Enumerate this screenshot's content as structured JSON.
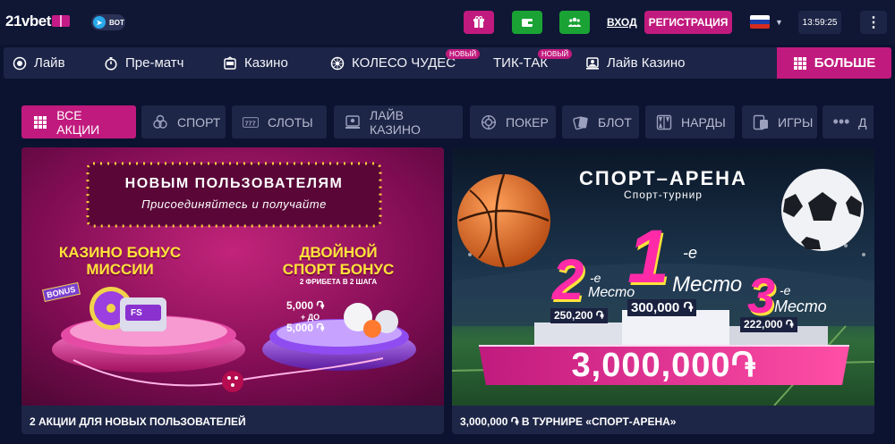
{
  "header": {
    "logo_text": "21vbet",
    "bot_label": "BOT",
    "login_label": "ВХОД",
    "register_label": "РЕГИСТРАЦИЯ",
    "time": "13:59:25",
    "language_flag": "ru",
    "icons": [
      "gift-icon",
      "wallet-icon",
      "group-icon",
      "telegram-icon",
      "chevron-down-icon",
      "kebab-icon"
    ]
  },
  "nav": {
    "items": [
      {
        "label": "Лайв",
        "icon": "live-icon"
      },
      {
        "label": "Пре-матч",
        "icon": "stopwatch-icon"
      },
      {
        "label": "Казино",
        "icon": "casino-icon"
      },
      {
        "label": "КОЛЕСО ЧУДЕС",
        "icon": "wheel-icon",
        "badge": "НОВЫЙ"
      },
      {
        "label": "ТИК-ТАК",
        "badge": "НОВЫЙ"
      },
      {
        "label": "Лайв Казино",
        "icon": "live-casino-icon"
      }
    ],
    "more_label": "БОЛЬШЕ"
  },
  "filters": {
    "tabs": [
      {
        "label": "ВСЕ АКЦИИ",
        "icon": "grid-icon",
        "active": true
      },
      {
        "label": "СПОРТ",
        "icon": "balls-icon"
      },
      {
        "label": "СЛОТЫ",
        "icon": "slots-icon"
      },
      {
        "label": "ЛАЙВ КАЗИНО",
        "icon": "live-casino-icon"
      },
      {
        "label": "ПОКЕР",
        "icon": "poker-chip-icon"
      },
      {
        "label": "БЛОТ",
        "icon": "cards-icon"
      },
      {
        "label": "НАРДЫ",
        "icon": "backgammon-icon"
      },
      {
        "label": "ИГРЫ",
        "icon": "games-icon"
      },
      {
        "label": "Д",
        "icon": "dots-icon"
      }
    ]
  },
  "promo1": {
    "banner_title": "НОВЫМ ПОЛЬЗОВАТЕЛЯМ",
    "banner_subtitle": "Присоединяйтесь и получайте",
    "casino_title_1": "КАЗИНО БОНУС",
    "casino_title_2": "МИССИИ",
    "bonus_tag": "BONUS",
    "fs_tag": "FS",
    "sport_title_1": "ДВОЙНОЙ",
    "sport_title_2": "СПОРТ БОНУС",
    "sport_subtitle": "2 ФРИБЕТА В 2 ШАГА",
    "amount_1": "5,000 ֏",
    "upto": "+ ДО",
    "amount_2": "5,000 ֏",
    "caption": "2 АКЦИИ ДЛЯ НОВЫХ ПОЛЬЗОВАТЕЛЕЙ"
  },
  "promo2": {
    "title": "СПОРТ–АРЕНА",
    "subtitle": "Спорт-турнир",
    "place1_num": "1",
    "place1_suffix": "-е",
    "place1_word": "Место",
    "place1_prize": "300,000 ֏",
    "place2_num": "2",
    "place2_suffix": "-е",
    "place2_word": "Место",
    "place2_prize": "250,200 ֏",
    "place3_num": "3",
    "place3_suffix": "-е",
    "place3_word": "Место",
    "place3_prize": "222,000 ֏",
    "total": "3,000,000֏",
    "caption": "3,000,000 ֏ В ТУРНИРЕ «СПОРТ-АРЕНА»"
  }
}
